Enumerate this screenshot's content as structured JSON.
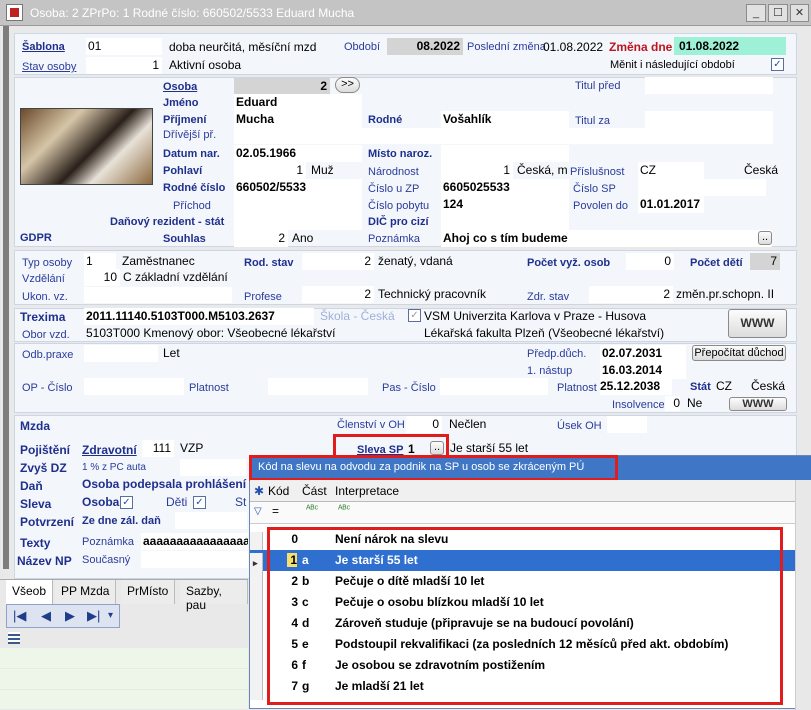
{
  "window": {
    "title": "Osoba: 2  ZPrPo: 1    Rodné číslo: 660502/5533   Eduard Mucha"
  },
  "top": {
    "sablona_label": "Šablona",
    "sablona_code": "01",
    "sablona_text": "doba neurčitá, měsíční mzd",
    "obdobi_label": "Období",
    "obdobi_value": "08.2022",
    "posledni_zmena_label": "Poslední změna",
    "posledni_zmena_value": "01.08.2022",
    "zmena_dne_label": "Změna dne",
    "zmena_dne_value": "01.08.2022",
    "stav_label": "Stav osoby",
    "stav_code": "1",
    "stav_text": "Aktivní osoba",
    "menit_label": "Měnit i následující období",
    "menit_checked": "✓"
  },
  "person": {
    "osoba_label": "Osoba",
    "osoba_value": "2",
    "osoba_btn": ">>",
    "jmeno_label": "Jméno",
    "jmeno_value": "Eduard",
    "drivejsi_label": "Dřívější př.",
    "prijmeni_label": "Příjmení",
    "prijmeni_value": "Mucha",
    "rodne_label": "Rodné",
    "rodne_value": "Vošahlík",
    "titul_pred_label": "Titul před",
    "titul_za_label": "Titul za",
    "datum_label": "Datum nar.",
    "datum_value": "02.05.1966",
    "misto_label": "Místo naroz.",
    "pohlavi_label": "Pohlaví",
    "pohlavi_code": "1",
    "pohlavi_text": "Muž",
    "narodnost_label": "Národnost",
    "narodnost_code": "1",
    "narodnost_text": "Česká, m",
    "prislusnost_label": "Příslušnost",
    "prislusnost_code": "CZ",
    "prislusnost_text": "Česká",
    "rc_label": "Rodné číslo",
    "rc_value": "660502/5533",
    "cislo_zp_label": "Číslo u ZP",
    "cislo_zp_value": "6605025533",
    "cislo_sp_label": "Číslo SP",
    "prichod_label": "Příchod",
    "cislo_pobytu_label": "Číslo pobytu",
    "cislo_pobytu_value": "124",
    "povolen_label": "Povolen do",
    "povolen_value": "01.01.2017",
    "danovy_label": "Daňový rezident - stát",
    "dic_label": "DIČ pro cizí",
    "gdpr_label": "GDPR",
    "souhlas_label": "Souhlas",
    "souhlas_code": "2",
    "souhlas_text": "Ano",
    "poznamka_label": "Poznámka",
    "poznamka_value": "Ahoj co s tím budeme",
    "poznamka_btn": ".."
  },
  "work": {
    "typ_label": "Typ osoby",
    "typ_code": "1",
    "typ_text": "Zaměstnanec",
    "rod_stav_label": "Rod. stav",
    "rod_stav_code": "2",
    "rod_stav_text": "ženatý, vdaná",
    "pocet_vyz_label": "Počet vyž. osob",
    "pocet_vyz_value": "0",
    "pocet_deti_label": "Počet dětí",
    "pocet_deti_value": "7",
    "vzdelani_label": "Vzdělání",
    "vzdelani_code": "10",
    "vzdelani_text": "C  základní vzdělání",
    "ukon_label": "Ukon. vz.",
    "profese_label": "Profese",
    "profese_code": "2",
    "profese_text": "Technický pracovník",
    "zdr_label": "Zdr. stav",
    "zdr_code": "2",
    "zdr_text": "změn.pr.schopn. II"
  },
  "edu": {
    "trexima_label": "Trexima",
    "trexima_value": "2011.11140.5103T000.M5103.2637",
    "skola_label": "Škola - Česká",
    "skola_check": "✓",
    "skola_value": "VSM Univerzita Karlova v Praze - Husova",
    "obor_label": "Obor vzd.",
    "obor_value": "5103T000 Kmenový obor: Všeobecné lékařství",
    "fakulta_value": "Lékařská fakulta Plzeň (Všeobecné lékařství)",
    "www_btn": "WWW"
  },
  "pension": {
    "odb_label": "Odb.praxe",
    "odb_value": "Let",
    "predp_label": "Předp.důch.",
    "predp_value": "02.07.2031",
    "prepocitat_btn": "Přepočítat důchod",
    "nastup_label": "1. nástup",
    "nastup_value": "16.03.2014",
    "op_label": "OP - Číslo",
    "platnost_label": "Platnost",
    "pas_label": "Pas - Číslo",
    "platnost2_label": "Platnost",
    "platnost2_value": "25.12.2038",
    "stat_label": "Stát",
    "stat_code": "CZ",
    "stat_text": "Česká",
    "insolvence_label": "Insolvence",
    "insolvence_code": "0",
    "insolvence_text": "Ne",
    "www_btn": "WWW"
  },
  "mzda": {
    "mzda_label": "Mzda",
    "clenstvi_label": "Členství v OH",
    "clenstvi_code": "0",
    "clenstvi_text": "Nečlen",
    "urok_label": "Úsek OH",
    "pojisteni_label": "Pojištění",
    "zdravotni_label": "Zdravotní",
    "zdravotni_code": "111",
    "zdravotni_text": "VZP",
    "sleva_sp_label": "Sleva SP",
    "sleva_sp_value": "1",
    "sleva_sp_btn": "..",
    "sleva_sp_text": "Je starší 55 let",
    "zvys_label": "Zvyš DZ",
    "zvys_sub": "1 % z PC auta",
    "dan_label": "Daň",
    "dan_text": "Osoba podepsala prohlášení",
    "sleva_label": "Sleva",
    "sleva_osoba": "Osoba",
    "sleva_deti": "Děti",
    "sleva_st": "St",
    "potvrzeni_label": "Potvrzení",
    "potvrzeni_text": "Ze dne zál. daň",
    "texty_label": "Texty",
    "texty_sub": "Poznámka",
    "texty_value": "aaaaaaaaaaaaaaaaa",
    "nazev_label": "Název NP",
    "nazev_sub": "Současný"
  },
  "tabs": [
    "Všeob",
    "PP Mzda",
    "PrMísto",
    "Sazby, pau"
  ],
  "popup": {
    "title": "Kód na slevu na odvodu za podnik na SP u osob se zkráceným PÚ",
    "col_kod": "Kód",
    "col_cast": "Část",
    "col_interp": "Interpretace",
    "filter_eq": "=",
    "filter_abc": "ᴬᴮᶜ",
    "rows": [
      {
        "kod": "0",
        "cast": "",
        "text": "Není nárok na slevu"
      },
      {
        "kod": "1",
        "cast": "a",
        "text": "Je starší 55 let"
      },
      {
        "kod": "2",
        "cast": "b",
        "text": "Pečuje o dítě mladší 10 let"
      },
      {
        "kod": "3",
        "cast": "c",
        "text": "Pečuje o osobu blízkou mladší 10 let"
      },
      {
        "kod": "4",
        "cast": "d",
        "text": "Zároveň studuje (připravuje se na budoucí povolání)"
      },
      {
        "kod": "5",
        "cast": "e",
        "text": "Podstoupil rekvalifikaci (za posledních 12 měsíců před akt. obdobím)"
      },
      {
        "kod": "6",
        "cast": "f",
        "text": "Je osobou se zdravotním postižením"
      },
      {
        "kod": "7",
        "cast": "g",
        "text": "Je mladší 21 let"
      }
    ]
  },
  "colors": {
    "accent": "#2a3c9c",
    "selection": "#2f6fcf",
    "highlight_red": "#e01c1c",
    "popup_title": "#3f76c5"
  }
}
